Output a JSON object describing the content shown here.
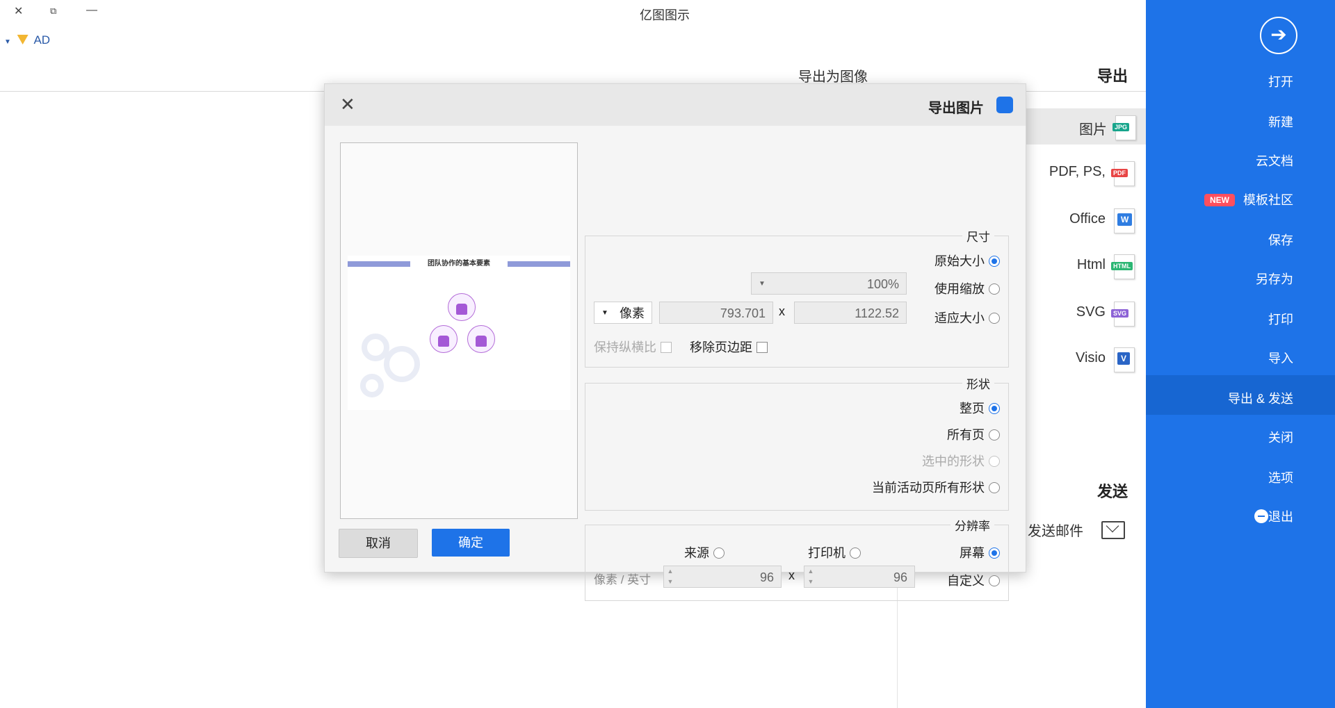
{
  "window": {
    "app_title": "亿图图示",
    "user": "AD",
    "controls": [
      "✕",
      "⧉",
      "—"
    ]
  },
  "sidebar": {
    "items": [
      "打开",
      "新建",
      "云文档",
      "模板社区",
      "保存",
      "另存为",
      "打印",
      "导入",
      "导出 & 发送",
      "关闭",
      "选项",
      "退出"
    ],
    "new_tag": "NEW",
    "active": "导出 & 发送"
  },
  "export_panel": {
    "title": "导出",
    "heading": "导出为图像",
    "file_types": [
      {
        "label": "图片",
        "tag": "JPG"
      },
      {
        "label": "PDF, PS,",
        "tag": "PDF"
      },
      {
        "label": "Office",
        "tag": "W"
      },
      {
        "label": "Html",
        "tag": "HTML"
      },
      {
        "label": "SVG",
        "tag": "SVG"
      },
      {
        "label": "Visio",
        "tag": "V"
      }
    ],
    "send_title": "发送",
    "send_mail": "发送邮件"
  },
  "dialog": {
    "title": "导出图片",
    "size_group": "尺寸",
    "original_size": "原始大小",
    "use_scale": "使用缩放",
    "scale_value": "100%",
    "fit_size": "适应大小",
    "width": "1122.52",
    "x": "x",
    "height": "793.701",
    "unit": "像素",
    "remove_margin": "移除页边距",
    "keep_ratio": "保持纵横比",
    "shape_group": "形状",
    "whole_page": "整页",
    "all_pages": "所有页",
    "selected_shapes": "选中的形状",
    "all_shapes_active": "当前活动页所有形状",
    "resolution_group": "分辨率",
    "screen": "屏幕",
    "printer": "打印机",
    "source": "来源",
    "custom": "自定义",
    "dpi_x": "96",
    "dpi_y": "96",
    "dpi_unit": "像素 / 英寸",
    "ok": "确定",
    "cancel": "取消",
    "preview_title": "团队协作的基本要素"
  }
}
